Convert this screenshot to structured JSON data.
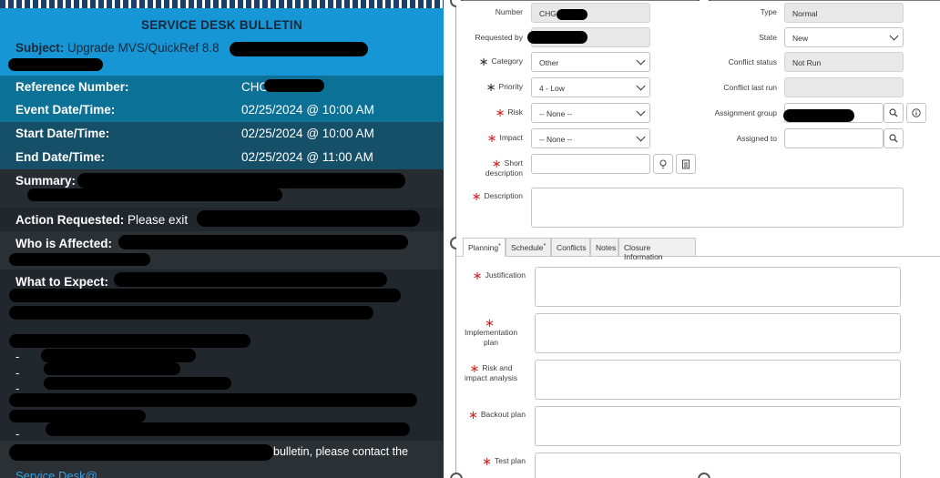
{
  "bulletin": {
    "title": "SERVICE DESK BULLETIN",
    "subject_label": "Subject:",
    "subject_value": "Upgrade MVS/QuickRef 8.8",
    "reference_label": "Reference Number:",
    "reference_value": "CHG",
    "event_label": "Event Date/Time:",
    "event_value": "02/25/2024 @ 10:00 AM",
    "start_label": "Start Date/Time:",
    "start_value": "02/25/2024 @ 10:00 AM",
    "end_label": "End Date/Time:",
    "end_value": "02/25/2024 @ 11:00 AM",
    "summary_label": "Summary:",
    "action_label": "Action Requested:",
    "action_value": "Please exit",
    "affected_label": "Who is Affected:",
    "expect_label": "What to Expect:",
    "dash": "-",
    "questions_fragment": "bulletin, please contact the",
    "contact_link": "Service Desk@..."
  },
  "form": {
    "number_label": "Number",
    "number_value": "CHG",
    "requested_by_label": "Requested by",
    "category_label": "Category",
    "category_value": "Other",
    "priority_label": "Priority",
    "priority_value": "4 - Low",
    "risk_label": "Risk",
    "risk_value": "-- None --",
    "impact_label": "Impact",
    "impact_value": "-- None --",
    "short_desc_label_1": "Short",
    "short_desc_label_2": "description",
    "description_label": "Description",
    "type_label": "Type",
    "type_value": "Normal",
    "state_label": "State",
    "state_value": "New",
    "conflict_status_label": "Conflict status",
    "conflict_status_value": "Not Run",
    "conflict_last_run_label": "Conflict last run",
    "assignment_group_label": "Assignment group",
    "assigned_to_label": "Assigned to"
  },
  "tabs": [
    {
      "label": "Planning",
      "required": true
    },
    {
      "label": "Schedule",
      "required": true
    },
    {
      "label": "Conflicts",
      "required": false
    },
    {
      "label": "Notes",
      "required": false
    },
    {
      "label": "Closure Information",
      "required": false
    }
  ],
  "planning": {
    "justification_label": "Justification",
    "implementation_label_1": "Implementation",
    "implementation_label_2": "plan",
    "risk_label_1": "Risk and",
    "risk_label_2": "impact analysis",
    "backout_label": "Backout plan",
    "test_label": "Test plan"
  },
  "icons": {
    "search": "magnifier-icon",
    "info": "info-icon",
    "suggest": "lightbulb-icon",
    "template": "template-icon"
  },
  "colors": {
    "header_blue": "#1696d4",
    "row_teal": "#0b7196",
    "row_dark_teal": "#154f68",
    "body_dark": "#21272c",
    "required_red": "#d22a2a"
  }
}
